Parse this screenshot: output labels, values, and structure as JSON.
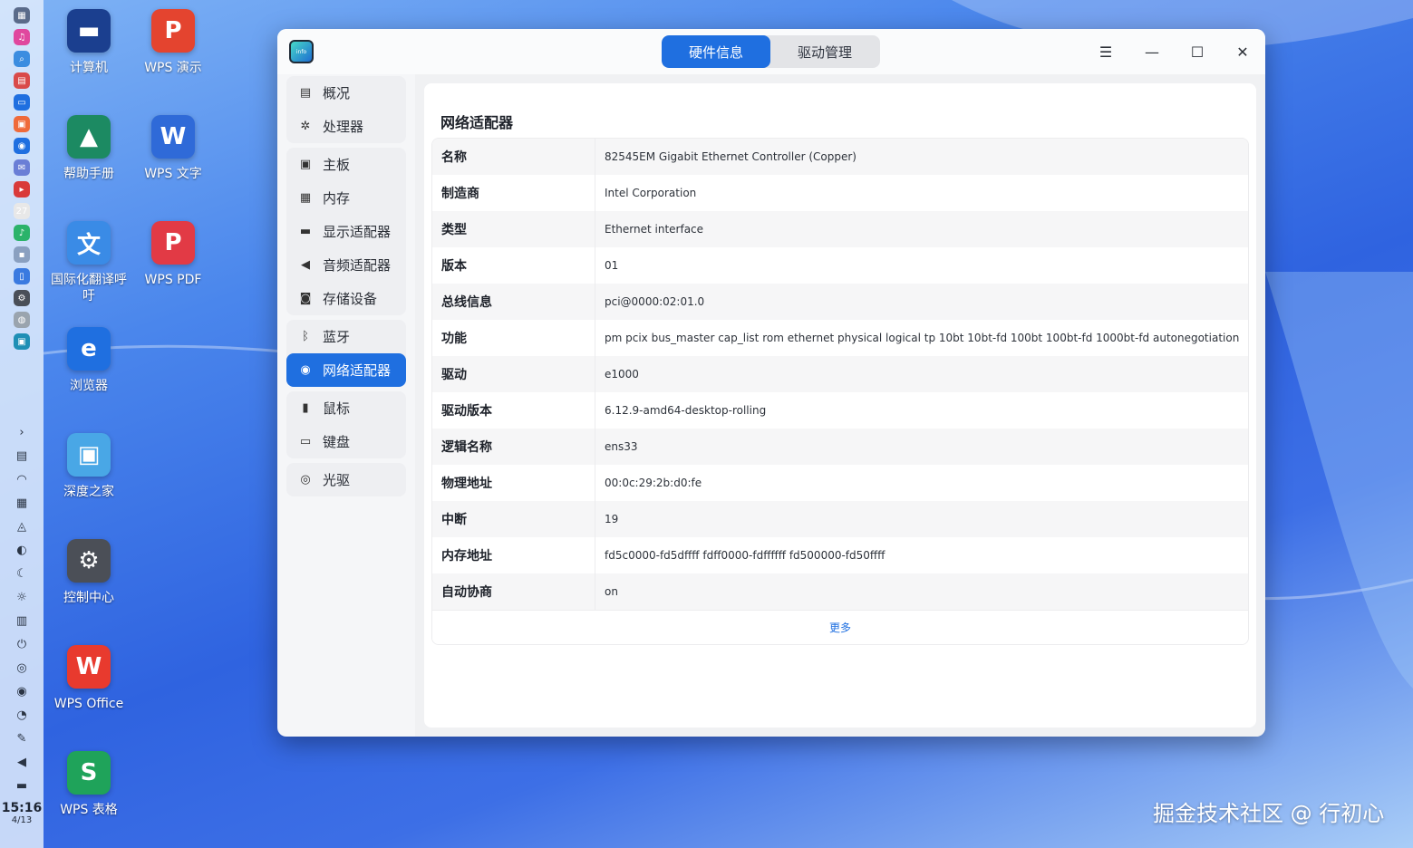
{
  "dock": {
    "apps": [
      {
        "name": "launcher-icon",
        "glyph": "▦",
        "color": "#5a6b8a"
      },
      {
        "name": "music-icon",
        "glyph": "♫",
        "color": "#e0479e"
      },
      {
        "name": "search-icon",
        "glyph": "⌕",
        "color": "#3b8de0"
      },
      {
        "name": "multitask-icon",
        "glyph": "▤",
        "color": "#d94a4a"
      },
      {
        "name": "file-manager-icon",
        "glyph": "▭",
        "color": "#1f6fe0"
      },
      {
        "name": "app-store-icon",
        "glyph": "▣",
        "color": "#ef6a3a"
      },
      {
        "name": "browser-icon",
        "glyph": "◉",
        "color": "#1f6fe0"
      },
      {
        "name": "mail-icon",
        "glyph": "✉",
        "color": "#6a7ed6"
      },
      {
        "name": "terminal-icon",
        "glyph": "▸",
        "color": "#d93a3a"
      },
      {
        "name": "calendar-icon",
        "glyph": "27",
        "color": "#e8e8e8"
      },
      {
        "name": "music-player-icon",
        "glyph": "♪",
        "color": "#2bb36a"
      },
      {
        "name": "screenshot-icon",
        "glyph": "▪",
        "color": "#8aa0c0"
      },
      {
        "name": "document-viewer-icon",
        "glyph": "▯",
        "color": "#3a7ae0"
      },
      {
        "name": "settings-icon",
        "glyph": "⚙",
        "color": "#4a4f58"
      },
      {
        "name": "device-manager-icon",
        "glyph": "◍",
        "color": "#9aa4ae"
      },
      {
        "name": "device-info-icon",
        "glyph": "▣",
        "color": "#1e8fb5"
      }
    ],
    "tray": [
      {
        "name": "expand-tray-icon",
        "glyph": "›"
      },
      {
        "name": "clipboard-icon",
        "glyph": "▤"
      },
      {
        "name": "network-icon",
        "glyph": "◠"
      },
      {
        "name": "keyboard-icon",
        "glyph": "▦"
      },
      {
        "name": "notification-icon",
        "glyph": "◬"
      },
      {
        "name": "theme-icon",
        "glyph": "◐"
      },
      {
        "name": "night-mode-icon",
        "glyph": "☾"
      },
      {
        "name": "brightness-icon",
        "glyph": "☼"
      },
      {
        "name": "onscreen-keyboard-icon",
        "glyph": "▥"
      },
      {
        "name": "power-icon",
        "glyph": "⏻"
      },
      {
        "name": "check-icon",
        "glyph": "◎"
      },
      {
        "name": "record-icon",
        "glyph": "◉"
      },
      {
        "name": "user-icon",
        "glyph": "◔"
      },
      {
        "name": "pen-icon",
        "glyph": "✎"
      },
      {
        "name": "volume-icon",
        "glyph": "◀"
      },
      {
        "name": "control-toggle-icon",
        "glyph": "▬"
      }
    ],
    "time": "15:16",
    "date": "4/13"
  },
  "desktop": {
    "icons": [
      {
        "label": "计算机",
        "glyph": "▬",
        "color": "#1b3f8f"
      },
      {
        "label": "WPS 演示",
        "glyph": "P",
        "color": "#e4442f"
      },
      {
        "label": "帮助手册",
        "glyph": "▲",
        "color": "#1c8a62"
      },
      {
        "label": "WPS 文字",
        "glyph": "W",
        "color": "#2f6ad8"
      },
      {
        "label": "国际化翻译呼吁",
        "glyph": "文",
        "color": "#3a8be6"
      },
      {
        "label": "WPS PDF",
        "glyph": "P",
        "color": "#e23a45"
      },
      {
        "label": "浏览器",
        "glyph": "e",
        "color": "#1f6fe0"
      },
      {
        "label": "深度之家",
        "glyph": "▣",
        "color": "#49a7e6"
      },
      {
        "label": "控制中心",
        "glyph": "⚙",
        "color": "#4b4f57"
      },
      {
        "label": "WPS Office",
        "glyph": "W",
        "color": "#e83a2e"
      },
      {
        "label": "WPS 表格",
        "glyph": "S",
        "color": "#1fa35a"
      }
    ]
  },
  "window": {
    "app_icon_text": "info",
    "tabs": [
      {
        "label": "硬件信息",
        "active": true
      },
      {
        "label": "驱动管理",
        "active": false
      }
    ],
    "controls": {
      "menu": "☰",
      "minimize": "—",
      "maximize": "☐",
      "close": "✕"
    },
    "sidebar": {
      "groups": [
        [
          {
            "label": "概况",
            "icon": "computer-icon",
            "glyph": "▤"
          },
          {
            "label": "处理器",
            "icon": "cpu-icon",
            "glyph": "✲"
          }
        ],
        [
          {
            "label": "主板",
            "icon": "motherboard-icon",
            "glyph": "▣"
          },
          {
            "label": "内存",
            "icon": "memory-icon",
            "glyph": "▦"
          },
          {
            "label": "显示适配器",
            "icon": "display-adapter-icon",
            "glyph": "▬"
          },
          {
            "label": "音频适配器",
            "icon": "audio-icon",
            "glyph": "◀"
          },
          {
            "label": "存储设备",
            "icon": "storage-icon",
            "glyph": "◙"
          }
        ],
        [
          {
            "label": "蓝牙",
            "icon": "bluetooth-icon",
            "glyph": "ᛒ"
          },
          {
            "label": "网络适配器",
            "icon": "network-adapter-icon",
            "glyph": "◉",
            "active": true
          }
        ],
        [
          {
            "label": "鼠标",
            "icon": "mouse-icon",
            "glyph": "▮"
          },
          {
            "label": "键盘",
            "icon": "keyboard-icon",
            "glyph": "▭"
          }
        ],
        [
          {
            "label": "光驱",
            "icon": "optical-drive-icon",
            "glyph": "◎"
          }
        ]
      ]
    },
    "content": {
      "title": "网络适配器",
      "rows": [
        {
          "key": "名称",
          "value": "82545EM Gigabit Ethernet Controller (Copper)"
        },
        {
          "key": "制造商",
          "value": "Intel Corporation"
        },
        {
          "key": "类型",
          "value": "Ethernet interface"
        },
        {
          "key": "版本",
          "value": "01"
        },
        {
          "key": "总线信息",
          "value": "pci@0000:02:01.0"
        },
        {
          "key": "功能",
          "value": "pm pcix bus_master cap_list rom ethernet physical logical tp 10bt 10bt-fd 100bt 100bt-fd 1000bt-fd autonegotiation"
        },
        {
          "key": "驱动",
          "value": "e1000"
        },
        {
          "key": "驱动版本",
          "value": "6.12.9-amd64-desktop-rolling"
        },
        {
          "key": "逻辑名称",
          "value": "ens33"
        },
        {
          "key": "物理地址",
          "value": "00:0c:29:2b:d0:fe"
        },
        {
          "key": "中断",
          "value": "19"
        },
        {
          "key": "内存地址",
          "value": "fd5c0000-fd5dffff  fdff0000-fdffffff  fd500000-fd50ffff"
        },
        {
          "key": "自动协商",
          "value": "on"
        }
      ],
      "more_label": "更多"
    }
  },
  "watermark": "掘金技术社区 @ 行初心"
}
